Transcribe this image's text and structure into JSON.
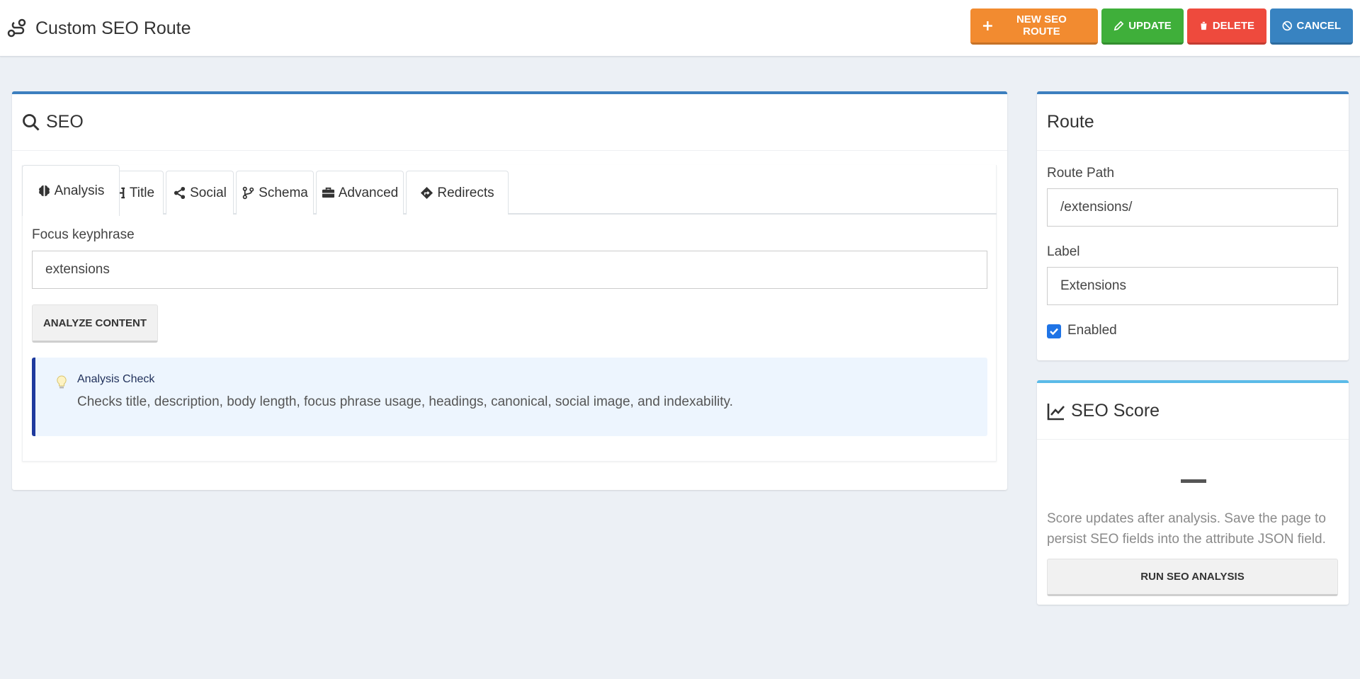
{
  "header": {
    "title": "Custom SEO Route",
    "buttons": {
      "new": "NEW SEO ROUTE",
      "update": "UPDATE",
      "delete": "DELETE",
      "cancel": "CANCEL"
    }
  },
  "seo_card": {
    "title": "SEO",
    "tabs": [
      {
        "label": "Analysis",
        "icon": "brain-icon",
        "active": true
      },
      {
        "label": "Title",
        "icon": "heading-icon",
        "active": false
      },
      {
        "label": "Social",
        "icon": "share-icon",
        "active": false
      },
      {
        "label": "Schema",
        "icon": "code-branch-icon",
        "active": false
      },
      {
        "label": "Advanced",
        "icon": "briefcase-icon",
        "active": false
      },
      {
        "label": "Redirects",
        "icon": "directions-icon",
        "active": false
      }
    ],
    "focus_label": "Focus keyphrase",
    "focus_value": "extensions",
    "analyze_button": "ANALYZE CONTENT",
    "callout": {
      "title": "Analysis Check",
      "text": "Checks title, description, body length, focus phrase usage, headings, canonical, social image, and indexability."
    }
  },
  "route_card": {
    "title": "Route",
    "path_label": "Route Path",
    "path_value": "/extensions/",
    "label_label": "Label",
    "label_value": "Extensions",
    "enabled_label": "Enabled",
    "enabled": true
  },
  "score_card": {
    "title": "SEO Score",
    "score": "—",
    "note": "Score updates after analysis. Save the page to persist SEO fields into the attribute JSON field.",
    "run_button": "RUN SEO ANALYSIS"
  },
  "colors": {
    "new": "#f28b30",
    "update": "#3faf3a",
    "delete": "#ee4a3d",
    "cancel": "#3883c1",
    "card_accent": "#3c7fbf",
    "score_accent": "#5bbbe8"
  }
}
